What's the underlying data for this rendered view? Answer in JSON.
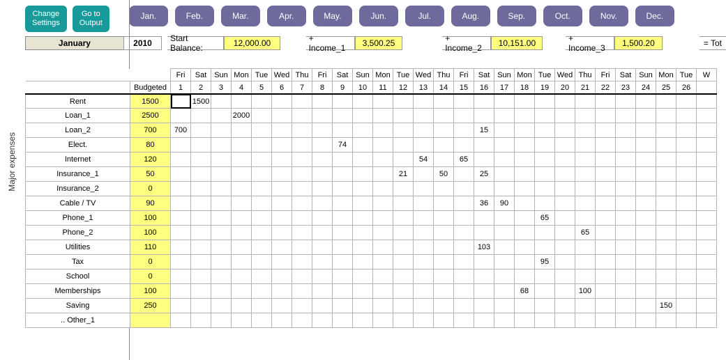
{
  "buttons": {
    "changeSettings": "Change\nSettings",
    "gotoOutput": "Go to\nOutput"
  },
  "months": [
    "Jan.",
    "Feb.",
    "Mar.",
    "Apr.",
    "May.",
    "Jun.",
    "Jul.",
    "Aug.",
    "Sep.",
    "Oct.",
    "Nov.",
    "Dec."
  ],
  "summary": {
    "month": "January",
    "year": "2010",
    "startBalanceLabel": "Start Balance:",
    "startBalance": "12,000.00",
    "income1Label": "+ Income_1",
    "income1": "3,500.25",
    "income2Label": "+ Income_2",
    "income2": "10,151.00",
    "income3Label": "+ Income_3",
    "income3": "1,500.20",
    "totalLabel": "= Tot"
  },
  "sideLabel": "Major expenses",
  "headers": {
    "budgeted": "Budgeted",
    "dow": [
      "Fri",
      "Sat",
      "Sun",
      "Mon",
      "Tue",
      "Wed",
      "Thu",
      "Fri",
      "Sat",
      "Sun",
      "Mon",
      "Tue",
      "Wed",
      "Thu",
      "Fri",
      "Sat",
      "Sun",
      "Mon",
      "Tue",
      "Wed",
      "Thu",
      "Fri",
      "Sat",
      "Sun",
      "Mon",
      "Tue",
      "W"
    ],
    "num": [
      "1",
      "2",
      "3",
      "4",
      "5",
      "6",
      "7",
      "8",
      "9",
      "10",
      "11",
      "12",
      "13",
      "14",
      "15",
      "16",
      "17",
      "18",
      "19",
      "20",
      "21",
      "22",
      "23",
      "24",
      "25",
      "26",
      ""
    ]
  },
  "rows": [
    {
      "label": "Rent",
      "budget": "1500",
      "cells": {
        "1": "1500"
      }
    },
    {
      "label": "Loan_1",
      "budget": "2500",
      "cells": {
        "3": "2000"
      }
    },
    {
      "label": "Loan_2",
      "budget": "700",
      "cells": {
        "0": "700",
        "15": "15"
      }
    },
    {
      "label": "Elect.",
      "budget": "80",
      "cells": {
        "8": "74"
      }
    },
    {
      "label": "Internet",
      "budget": "120",
      "cells": {
        "12": "54",
        "14": "65"
      }
    },
    {
      "label": "Insurance_1",
      "budget": "50",
      "cells": {
        "11": "21",
        "13": "50",
        "15": "25"
      }
    },
    {
      "label": "Insurance_2",
      "budget": "0",
      "cells": {}
    },
    {
      "label": "Cable / TV",
      "budget": "90",
      "cells": {
        "15": "36",
        "16": "90"
      }
    },
    {
      "label": "Phone_1",
      "budget": "100",
      "cells": {
        "18": "65"
      }
    },
    {
      "label": "Phone_2",
      "budget": "100",
      "cells": {
        "20": "65"
      }
    },
    {
      "label": "Utilities",
      "budget": "110",
      "cells": {
        "15": "103"
      }
    },
    {
      "label": "Tax",
      "budget": "0",
      "cells": {
        "18": "95"
      }
    },
    {
      "label": "School",
      "budget": "0",
      "cells": {}
    },
    {
      "label": "Memberships",
      "budget": "100",
      "cells": {
        "17": "68",
        "20": "100"
      }
    },
    {
      "label": "Saving",
      "budget": "250",
      "cells": {
        "24": "150"
      }
    },
    {
      "label": ".. Other_1",
      "budget": "",
      "cells": {}
    }
  ]
}
